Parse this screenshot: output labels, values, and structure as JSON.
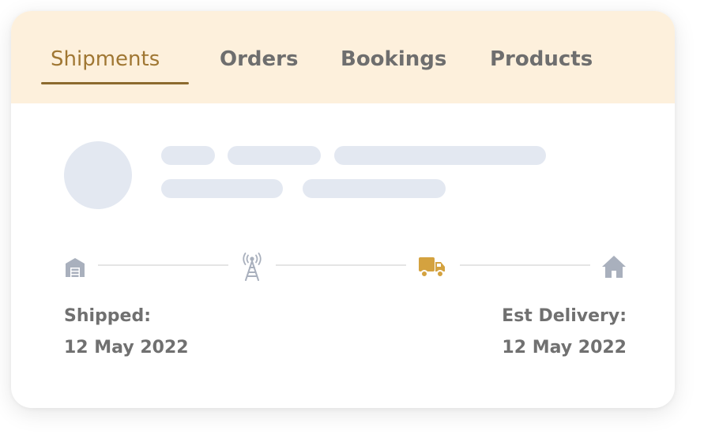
{
  "tabs": [
    {
      "label": "Shipments",
      "active": true
    },
    {
      "label": "Orders",
      "active": false
    },
    {
      "label": "Bookings",
      "active": false
    },
    {
      "label": "Products",
      "active": false
    }
  ],
  "tracking": {
    "stages": [
      {
        "icon": "warehouse-icon",
        "state": "inactive"
      },
      {
        "icon": "radio-tower-icon",
        "state": "inactive"
      },
      {
        "icon": "delivery-truck-icon",
        "state": "current"
      },
      {
        "icon": "home-icon",
        "state": "inactive"
      }
    ]
  },
  "shipped": {
    "label": "Shipped:",
    "date": "12 May 2022"
  },
  "delivery": {
    "label": "Est Delivery:",
    "date": "12 May 2022"
  },
  "colors": {
    "tab_bar_bg": "#fdf0dc",
    "active_tab": "#a07733",
    "inactive_tab": "#6e6e6e",
    "skeleton": "#e3e8f1",
    "icon_inactive": "#a9b0bd",
    "icon_active": "#d4a23f"
  }
}
